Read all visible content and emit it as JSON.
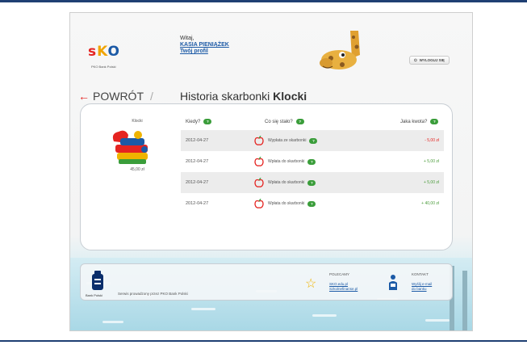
{
  "header": {
    "logo": "SKO",
    "logo_sub": "PKO Bank Polski",
    "greeting": "Witaj,",
    "user_name": "KASIA PIENIĄŻEK",
    "profile_link": "Twój profil",
    "logout": "WYLOGUJ SIĘ"
  },
  "nav": {
    "back": "POWRÓT",
    "separator": "/",
    "title_prefix": "Historia skarbonki",
    "title_name": "Klocki"
  },
  "piggybank": {
    "name": "Klocki",
    "amount": "45,00 zł"
  },
  "table": {
    "headers": {
      "when": "Kiedy?",
      "what": "Co się stało?",
      "amount": "Jaka kwota?",
      "help": "?"
    },
    "rows": [
      {
        "date": "2012-04-27",
        "desc": "Wypłata ze skarbonki",
        "amount": "- 5,00 zł",
        "type": "neg"
      },
      {
        "date": "2012-04-27",
        "desc": "Wpłata do skarbonki",
        "amount": "+ 5,00 zł",
        "type": "pos"
      },
      {
        "date": "2012-04-27",
        "desc": "Wpłata do skarbonki",
        "amount": "+ 5,00 zł",
        "type": "pos"
      },
      {
        "date": "2012-04-27",
        "desc": "Wpłata do skarbonki",
        "amount": "+ 40,00 zł",
        "type": "pos"
      }
    ]
  },
  "footer": {
    "bank_name": "Bank Polski",
    "served_by": "Serwis prowadzony przez PKO Bank Polski",
    "recommend_title": "POLECAMY",
    "recommend_link1": "SKO.edu.pl",
    "recommend_link2": "Szkolnefinanse.pl",
    "contact_title": "KONTAKT",
    "contact_link1": "Wyślij e-mail",
    "contact_link2": "do banku"
  },
  "colors": {
    "accent_red": "#e52421",
    "link_blue": "#1c5aa6",
    "help_green": "#3a9d3a",
    "rule_navy": "#1f3f73"
  }
}
